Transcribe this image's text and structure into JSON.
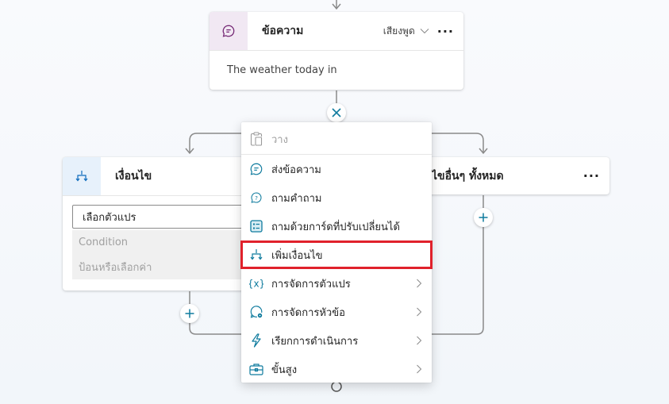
{
  "message_node": {
    "title": "ข้อความ",
    "speech_label": "เสียงพูด",
    "body_text": "The weather today in",
    "icon": "chat-bubble-icon",
    "accent_color": "#742774",
    "tile_color": "#f1e8f3"
  },
  "condition_node": {
    "title": "เงื่อนไข",
    "icon": "branch-icon",
    "variable_placeholder": "เลือกตัวแปร",
    "operator_placeholder": "Condition",
    "value_placeholder": "ป้อนหรือเลือกค่า",
    "tile_color": "#e7f1fb",
    "accent_color": "#0f6cbd"
  },
  "else_node": {
    "title_visible": "ไขอื่นๆ ทั้งหมด"
  },
  "context_menu": {
    "items": [
      {
        "label": "วาง",
        "icon": "clipboard-paste-icon",
        "disabled": true,
        "submenu": false
      },
      {
        "label": "ส่งข้อความ",
        "icon": "chat-bubble-icon",
        "disabled": false,
        "submenu": false
      },
      {
        "label": "ถามคำถาม",
        "icon": "question-bubble-icon",
        "disabled": false,
        "submenu": false
      },
      {
        "label": "ถามด้วยการ์ดที่ปรับเปลี่ยนได้",
        "icon": "adaptive-card-icon",
        "disabled": false,
        "submenu": false
      },
      {
        "label": "เพิ่มเงื่อนไข",
        "icon": "branch-icon",
        "disabled": false,
        "submenu": false,
        "highlighted": true
      },
      {
        "label": "การจัดการตัวแปร",
        "icon": "variable-icon",
        "disabled": false,
        "submenu": true
      },
      {
        "label": "การจัดการหัวข้อ",
        "icon": "topic-settings-icon",
        "disabled": false,
        "submenu": true
      },
      {
        "label": "เรียกการดำเนินการ",
        "icon": "lightning-icon",
        "disabled": false,
        "submenu": true
      },
      {
        "label": "ขั้นสูง",
        "icon": "toolbox-icon",
        "disabled": false,
        "submenu": true
      }
    ],
    "icon_color": "#0f7b9e",
    "highlight_color": "#e0212b"
  }
}
